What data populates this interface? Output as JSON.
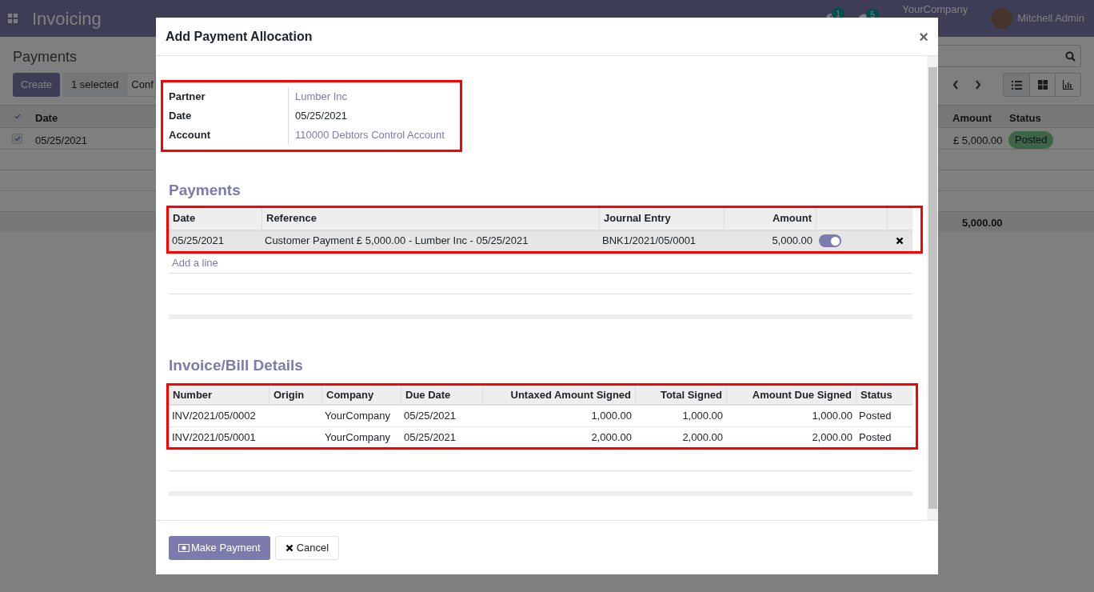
{
  "navbar": {
    "app_title": "Invoicing",
    "activity_count": "1",
    "message_count": "5",
    "company": "YourCompany",
    "user": "Mitchell Admin"
  },
  "control_panel": {
    "title": "Payments",
    "buttons": [
      {
        "label": "Create",
        "kind": "primary"
      },
      {
        "label": "1 selected",
        "kind": "info"
      },
      {
        "label": "Conf",
        "kind": "secondary"
      }
    ]
  },
  "list": {
    "all_selected": true,
    "columns_left": [
      "Date"
    ],
    "columns_right": [
      "Amount",
      "Status"
    ],
    "rows": [
      {
        "selected": true,
        "date": "05/25/2021",
        "amount": "£ 5,000.00",
        "status": "Posted"
      }
    ],
    "total": "5,000.00"
  },
  "dialog": {
    "title": "Add Payment Allocation",
    "close": "×",
    "header_group": {
      "highlighted": true,
      "fields": [
        {
          "label": "Partner",
          "value": "Lumber Inc",
          "kind": "link"
        },
        {
          "label": "Date",
          "value": "05/25/2021",
          "kind": "text"
        },
        {
          "label": "Account",
          "value": "110000 Debtors Control Account",
          "kind": "link"
        }
      ]
    },
    "payments": {
      "title": "Payments",
      "highlighted": true,
      "columns": [
        "Date",
        "Reference",
        "Journal Entry",
        "Amount"
      ],
      "rows": [
        {
          "date": "05/25/2021",
          "reference": "Customer Payment £ 5,000.00 - Lumber Inc - 05/25/2021",
          "journal_entry": "BNK1/2021/05/0001",
          "amount": "5,000.00",
          "on": true
        }
      ],
      "add_line": "Add a line"
    },
    "invoices": {
      "title": "Invoice/Bill Details",
      "highlighted": true,
      "columns": [
        "Number",
        "Origin",
        "Company",
        "Due Date",
        "Untaxed Amount Signed",
        "Total Signed",
        "Amount Due Signed",
        "Status"
      ],
      "rows": [
        [
          "INV/2021/05/0002",
          "",
          "YourCompany",
          "05/25/2021",
          "1,000.00",
          "1,000.00",
          "1,000.00",
          "Posted"
        ],
        [
          "INV/2021/05/0001",
          "",
          "YourCompany",
          "05/25/2021",
          "2,000.00",
          "2,000.00",
          "2,000.00",
          "Posted"
        ]
      ]
    },
    "buttons": [
      {
        "label": "Make Payment",
        "kind": "primary"
      },
      {
        "label": "Cancel",
        "kind": "secondary"
      }
    ]
  }
}
